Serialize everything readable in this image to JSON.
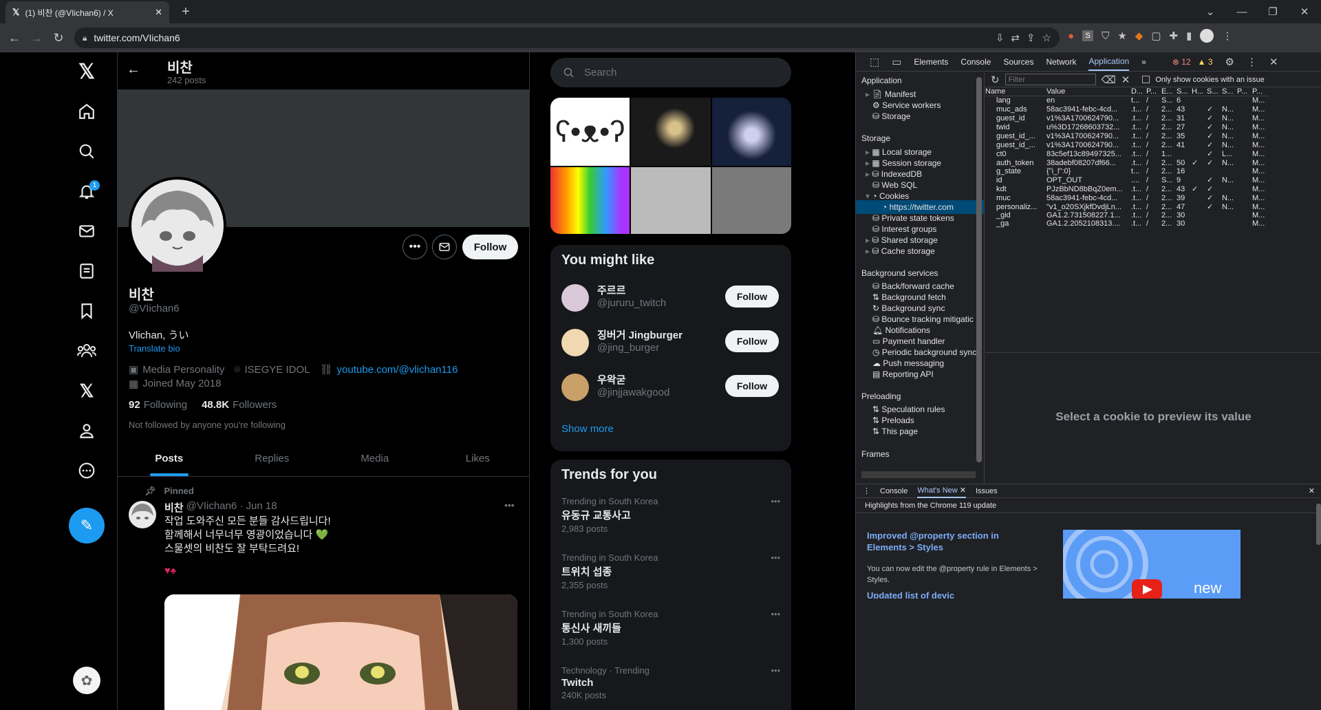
{
  "browser": {
    "tab_title": "(1) 비찬 (@VIichan6) / X",
    "url": "twitter.com/VIichan6"
  },
  "profile": {
    "name": "비찬",
    "post_count": "242 posts",
    "handle": "@VIichan6",
    "bio": "Vlichan, うい",
    "translate": "Translate bio",
    "category": "Media Personality",
    "location": "ISEGYE IDOL",
    "link": "youtube.com/@vlichan116",
    "joined": "Joined May 2018",
    "following_count": "92",
    "following_label": "Following",
    "followers_count": "48.8K",
    "followers_label": "Followers",
    "not_followed": "Not followed by anyone you're following",
    "follow_label": "Follow"
  },
  "tabs": [
    "Posts",
    "Replies",
    "Media",
    "Likes"
  ],
  "pinned": {
    "label": "Pinned",
    "name": "비찬",
    "meta": "@VIichan6 · Jun 18",
    "line1": "작업 도와주신 모든 분들 감사드립니다!",
    "line2": "함께해서 너무너무 영광이었습니다 💚",
    "line3": "스물셋의 비찬도 잘 부탁드려요!",
    "emoji": "♥♠"
  },
  "notif_badge": "1",
  "search_placeholder": "Search",
  "you_might_like": {
    "title": "You might like",
    "users": [
      {
        "name": "주르르",
        "handle": "@jururu_twitch",
        "follow": "Follow"
      },
      {
        "name": "징버거 Jingburger",
        "handle": "@jing_burger",
        "follow": "Follow"
      },
      {
        "name": "우왁굳",
        "handle": "@jinjjawakgood",
        "follow": "Follow"
      }
    ],
    "show_more": "Show more"
  },
  "trends": {
    "title": "Trends for you",
    "items": [
      {
        "cat": "Trending in South Korea",
        "name": "유동규 교통사고",
        "count": "2,983 posts"
      },
      {
        "cat": "Trending in South Korea",
        "name": "트위치 섭종",
        "count": "2,355 posts"
      },
      {
        "cat": "Trending in South Korea",
        "name": "통신사 새끼들",
        "count": "1,300 posts"
      },
      {
        "cat": "Technology · Trending",
        "name": "Twitch",
        "count": "240K posts"
      }
    ]
  },
  "devtools": {
    "tabs": [
      "Elements",
      "Console",
      "Sources",
      "Network",
      "Application"
    ],
    "errors": "12",
    "warnings": "3",
    "filter_placeholder": "Filter",
    "only_issue": "Only show cookies with an issue",
    "sections": {
      "application": "Application",
      "storage": "Storage",
      "background": "Background services",
      "preloading": "Preloading",
      "frames": "Frames"
    },
    "app_items": [
      "Manifest",
      "Service workers",
      "Storage"
    ],
    "storage_items": [
      "Local storage",
      "Session storage",
      "IndexedDB",
      "Web SQL",
      "Cookies",
      "https://twitter.com",
      "Private state tokens",
      "Interest groups",
      "Shared storage",
      "Cache storage"
    ],
    "bg_items": [
      "Back/forward cache",
      "Background fetch",
      "Background sync",
      "Bounce tracking mitigatic",
      "Notifications",
      "Payment handler",
      "Periodic background sync",
      "Push messaging",
      "Reporting API"
    ],
    "pre_items": [
      "Speculation rules",
      "Preloads",
      "This page"
    ],
    "columns": [
      "Name",
      "Value",
      "D...",
      "P...",
      "E...",
      "S...",
      "H...",
      "S...",
      "S...",
      "P...",
      "P..."
    ],
    "cookies": [
      [
        "lang",
        "en",
        "t...",
        "/",
        "S...",
        "6",
        "",
        "",
        "",
        "",
        "M..."
      ],
      [
        "muc_ads",
        "58ac3941-febc-4cd...",
        ".t...",
        "/",
        "2...",
        "43",
        "",
        "✓",
        "N...",
        "",
        "M..."
      ],
      [
        "guest_id",
        "v1%3A1700624790...",
        ".t...",
        "/",
        "2...",
        "31",
        "",
        "✓",
        "N...",
        "",
        "M..."
      ],
      [
        "twid",
        "u%3D17268603732...",
        ".t...",
        "/",
        "2...",
        "27",
        "",
        "✓",
        "N...",
        "",
        "M..."
      ],
      [
        "guest_id_...",
        "v1%3A1700624790...",
        ".t...",
        "/",
        "2...",
        "35",
        "",
        "✓",
        "N...",
        "",
        "M..."
      ],
      [
        "guest_id_...",
        "v1%3A1700624790...",
        ".t...",
        "/",
        "2...",
        "41",
        "",
        "✓",
        "N...",
        "",
        "M..."
      ],
      [
        "ct0",
        "83c5ef13c89497325...",
        ".t...",
        "/",
        "1...",
        "",
        "",
        "✓",
        "L...",
        "",
        "M..."
      ],
      [
        "auth_token",
        "38adebf08207df66...",
        ".t...",
        "/",
        "2...",
        "50",
        "✓",
        "✓",
        "N...",
        "",
        "M..."
      ],
      [
        "g_state",
        "{\"i_l\":0}",
        "t...",
        "/",
        "2...",
        "16",
        "",
        "",
        "",
        "",
        "M..."
      ],
      [
        "id",
        "OPT_OUT",
        "....",
        "/",
        "S...",
        "9",
        "",
        "✓",
        "N...",
        "",
        "M..."
      ],
      [
        "kdt",
        "PJzBbND8bBqZ0em...",
        ".t...",
        "/",
        "2...",
        "43",
        "✓",
        "✓",
        "",
        "",
        "M..."
      ],
      [
        "muc",
        "58ac3941-febc-4cd...",
        ".t...",
        "/",
        "2...",
        "39",
        "",
        "✓",
        "N...",
        "",
        "M..."
      ],
      [
        "personaliz...",
        "\"v1_o20SXjkfDvdjLn...",
        ".t...",
        "/",
        "2...",
        "47",
        "",
        "✓",
        "N...",
        "",
        "M..."
      ],
      [
        "_gid",
        "GA1.2.731508227.1...",
        ".t...",
        "/",
        "2...",
        "30",
        "",
        "",
        "",
        "",
        "M..."
      ],
      [
        "_ga",
        "GA1.2.2052108313....",
        ".t...",
        "/",
        "2...",
        "30",
        "",
        "",
        "",
        "",
        "M..."
      ]
    ],
    "preview": "Select a cookie to preview its value",
    "drawer_tabs": [
      "Console",
      "What's New",
      "Issues"
    ],
    "highlights": "Highlights from the Chrome 119 update",
    "news_title": "Improved @property section in Elements > Styles",
    "news_body": "You can now edit the @property rule in Elements > Styles.",
    "news_next": "Updated list of devic",
    "video_label": "new"
  }
}
